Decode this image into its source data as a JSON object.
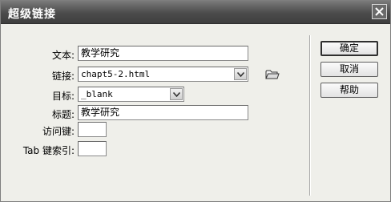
{
  "window": {
    "title": "超级链接"
  },
  "form": {
    "text_label": "文本:",
    "text_value": "教学研究",
    "link_label": "链接:",
    "link_value": "chapt5-2.html",
    "target_label": "目标:",
    "target_value": "_blank",
    "title_label": "标题:",
    "title_value": "教学研究",
    "accesskey_label": "访问键:",
    "accesskey_value": "",
    "tabindex_label": "Tab 键索引:",
    "tabindex_value": ""
  },
  "buttons": {
    "ok": "确定",
    "cancel": "取消",
    "help": "帮助"
  },
  "icons": {
    "close": "close-icon",
    "dropdown": "chevron-down-icon",
    "folder": "folder-icon"
  }
}
